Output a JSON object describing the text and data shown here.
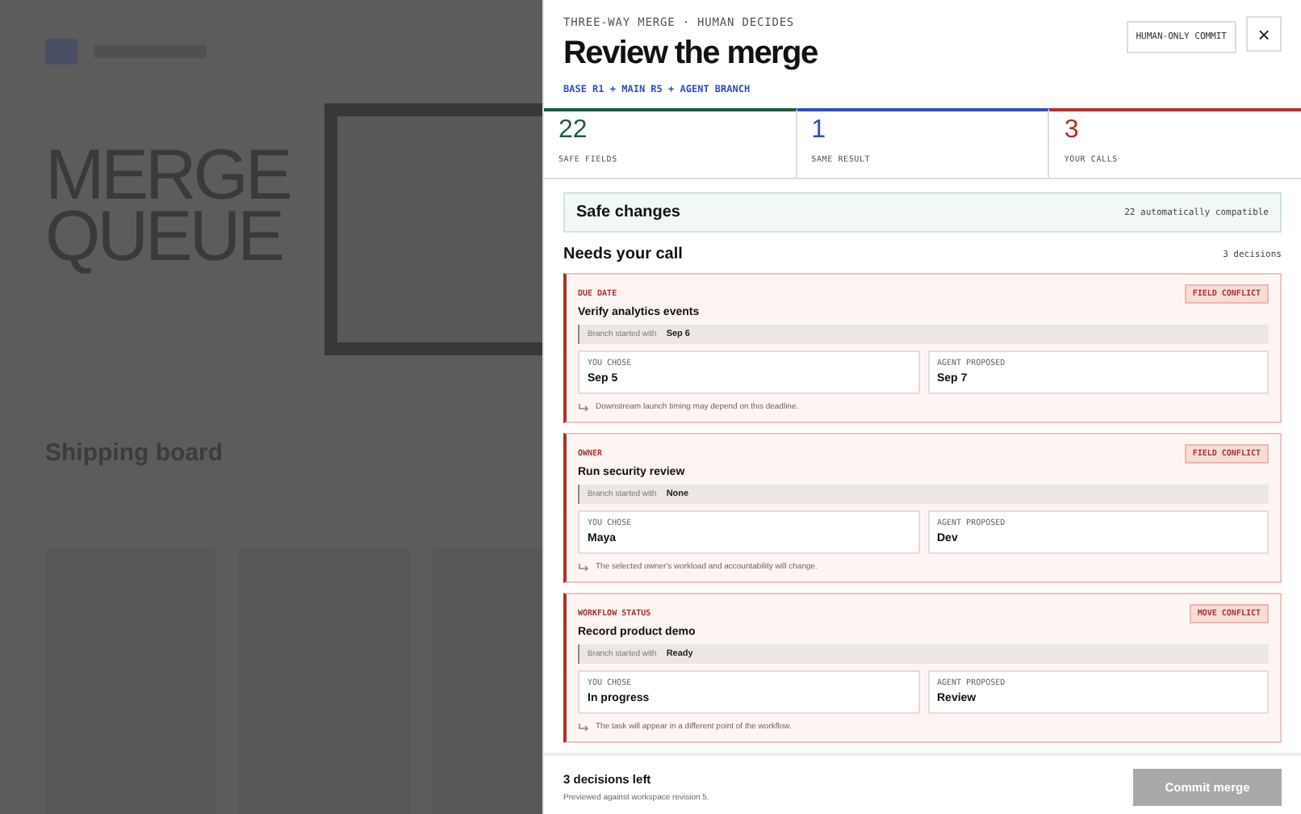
{
  "backdrop": {
    "hero_lines": [
      "MERGE",
      "QUEUE"
    ],
    "board_title": "Shipping board"
  },
  "panel": {
    "eyebrow": "THREE-WAY MERGE · HUMAN DECIDES",
    "title": "Review the merge",
    "sources": "BASE R1 + MAIN R5 + AGENT BRANCH",
    "mode_badge": "HUMAN-ONLY COMMIT",
    "close": "×"
  },
  "stats": [
    {
      "value": "22",
      "label": "SAFE FIELDS",
      "color": "#1e5e3f"
    },
    {
      "value": "1",
      "label": "SAME RESULT",
      "color": "#2f4fc4"
    },
    {
      "value": "3",
      "label": "YOUR CALLS",
      "color": "#b0302a"
    }
  ],
  "safe_changes": {
    "title": "Safe changes",
    "note": "22 automatically compatible"
  },
  "needs_call": {
    "title": "Needs your call",
    "count": "3 decisions"
  },
  "conflicts": [
    {
      "field": "DUE DATE",
      "task": "Verify analytics events",
      "badge": "FIELD CONFLICT",
      "base_label": "Branch started with",
      "base": "Sep 6",
      "yours_label": "YOU CHOSE",
      "yours": "Sep 5",
      "agent_label": "AGENT PROPOSED",
      "agent": "Sep 7",
      "impact": "Downstream launch timing may depend on this deadline."
    },
    {
      "field": "OWNER",
      "task": "Run security review",
      "badge": "FIELD CONFLICT",
      "base_label": "Branch started with",
      "base": "None",
      "yours_label": "YOU CHOSE",
      "yours": "Maya",
      "agent_label": "AGENT PROPOSED",
      "agent": "Dev",
      "impact": "The selected owner's workload and accountability will change."
    },
    {
      "field": "WORKFLOW STATUS",
      "task": "Record product demo",
      "badge": "MOVE CONFLICT",
      "base_label": "Branch started with",
      "base": "Ready",
      "yours_label": "YOU CHOSE",
      "yours": "In progress",
      "agent_label": "AGENT PROPOSED",
      "agent": "Review",
      "impact": "The task will appear in a different point of the workflow."
    }
  ],
  "footer": {
    "status": "3 decisions left",
    "note": "Previewed against workspace revision 5.",
    "commit": {
      "label": "Commit merge",
      "disabled": true
    }
  }
}
